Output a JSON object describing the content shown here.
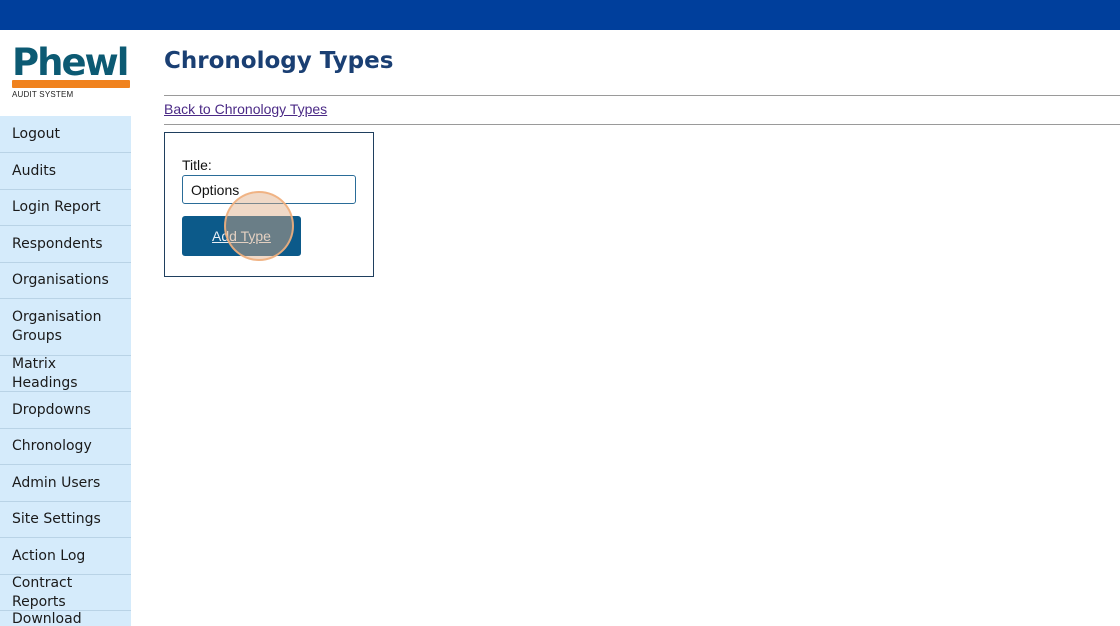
{
  "logo": {
    "word": "Phewl",
    "tagline": "AUDIT SYSTEM"
  },
  "sidebar": {
    "items": [
      {
        "label": "Logout"
      },
      {
        "label": "Audits"
      },
      {
        "label": "Login Report"
      },
      {
        "label": "Respondents"
      },
      {
        "label": "Organisations"
      },
      {
        "label": "Organisation Groups"
      },
      {
        "label": "Matrix Headings"
      },
      {
        "label": "Dropdowns"
      },
      {
        "label": "Chronology"
      },
      {
        "label": "Admin Users"
      },
      {
        "label": "Site Settings"
      },
      {
        "label": "Action Log"
      },
      {
        "label": "Contract Reports"
      },
      {
        "label": "Download Users"
      }
    ]
  },
  "main": {
    "title": "Chronology Types",
    "back_link": "Back to Chronology Types",
    "form": {
      "title_label": "Title:",
      "title_value": "Options",
      "submit_label": "Add Type"
    }
  },
  "colors": {
    "topbar": "#003f9c",
    "sidebar_bg": "#d5ebfb",
    "title": "#1a3f73",
    "button": "#0c5a8a",
    "logo_accent": "#f0821e"
  }
}
